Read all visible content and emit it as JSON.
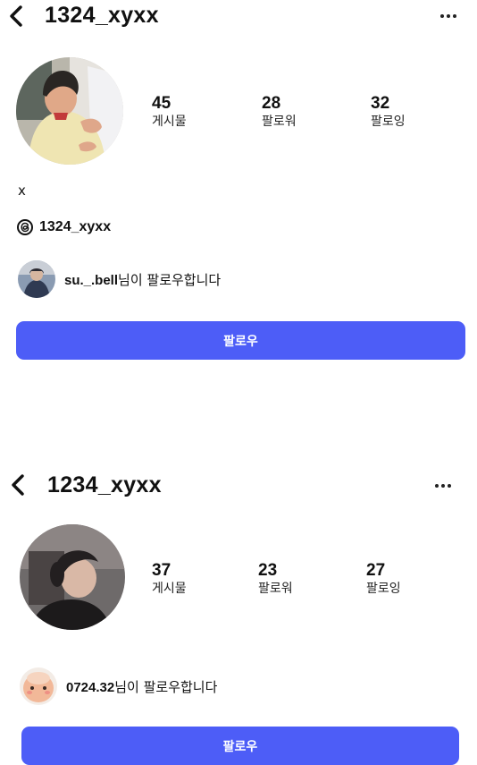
{
  "profiles": [
    {
      "username": "1324_xyxx",
      "stats": [
        {
          "count": "45",
          "label": "게시물"
        },
        {
          "count": "28",
          "label": "팔로워"
        },
        {
          "count": "32",
          "label": "팔로잉"
        }
      ],
      "bio": "x",
      "threads_handle": "1324_xyxx",
      "followed_by": {
        "name": "su._.bell",
        "suffix": "님이 팔로우합니다"
      },
      "follow_button": "팔로우"
    },
    {
      "username": "1234_xyxx",
      "stats": [
        {
          "count": "37",
          "label": "게시물"
        },
        {
          "count": "23",
          "label": "팔로워"
        },
        {
          "count": "27",
          "label": "팔로잉"
        }
      ],
      "followed_by": {
        "name": "0724.32",
        "suffix": "님이 팔로우합니다"
      },
      "follow_button": "팔로우"
    }
  ],
  "icons": {
    "back": "chevron-left-icon",
    "more": "more-horizontal-icon",
    "threads": "threads-icon"
  },
  "colors": {
    "accent": "#4d5df7",
    "text": "#111111",
    "background": "#ffffff"
  }
}
